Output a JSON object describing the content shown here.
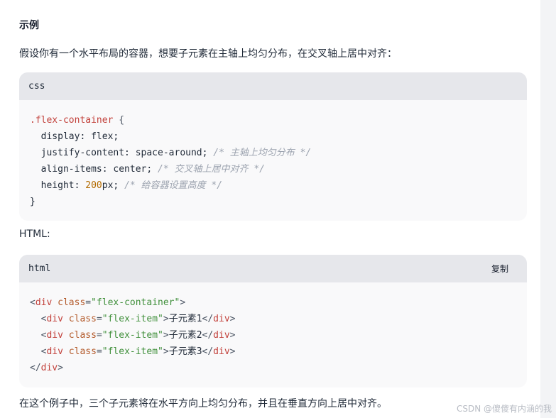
{
  "heading": "示例",
  "intro": "假设你有一个水平布局的容器，想要子元素在主轴上均匀分布，在交叉轴上居中对齐：",
  "css_block": {
    "language": "css",
    "lines": {
      "l1_selector": ".flex-container",
      "l1_brace": " {",
      "l2": "  display: flex;",
      "l3_code": "  justify-content: space-around; ",
      "l3_comment": "/* 主轴上均匀分布 */",
      "l4_code": "  align-items: center; ",
      "l4_comment": "/* 交叉轴上居中对齐 */",
      "l5_prop": "  height: ",
      "l5_num": "200",
      "l5_rest": "px; ",
      "l5_comment": "/* 给容器设置高度 */",
      "l6": "}"
    }
  },
  "html_label": "HTML:",
  "html_block": {
    "language": "html",
    "copy_label": "复制",
    "outer_open": {
      "lt": "<",
      "tag": "div",
      "attr": " class",
      "eq": "=",
      "val": "\"flex-container\"",
      "gt": ">"
    },
    "items": [
      {
        "text": "子元素1"
      },
      {
        "text": "子元素2"
      },
      {
        "text": "子元素3"
      }
    ],
    "item_tag": "div",
    "item_attr": " class",
    "item_val": "\"flex-item\"",
    "outer_close": {
      "lt": "</",
      "tag": "div",
      "gt": ">"
    }
  },
  "conclusion": "在这个例子中，三个子元素将在水平方向上均匀分布，并且在垂直方向上居中对齐。",
  "watermark": "CSDN @傻傻有内涵的我"
}
